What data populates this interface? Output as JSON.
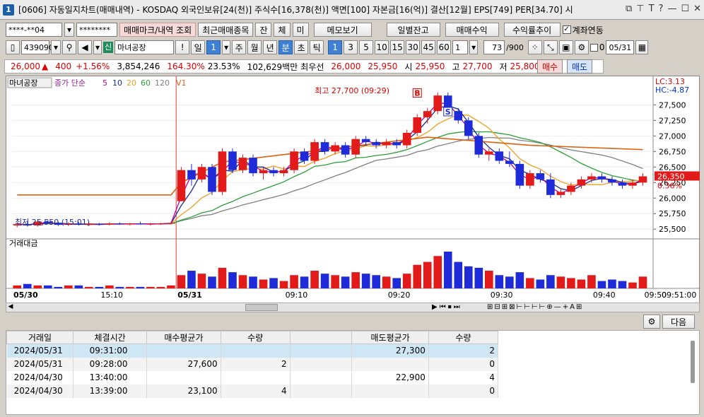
{
  "title": {
    "num": "1",
    "text": "[0606] 자동일지차트(매매내역) - KOSDAQ 외국인보유[24(천)] 주식수[16,378(천)] 액면[100] 자본금[16(억)] 결산[12월] EPS[749] PER[34.70] 시"
  },
  "toolbar1": {
    "account": "****-**04",
    "password": "********",
    "trade_mark": "매매마크/내역 조회",
    "recent": "최근매매종목",
    "b_jan": "잔",
    "b_che": "체",
    "b_mi": "미",
    "memo": "메모보기",
    "daily": "일별잔고",
    "profit": "매매수익",
    "rate": "수익률추이",
    "link": "계좌연동"
  },
  "toolbar2": {
    "code": "439090",
    "badge": "신",
    "name": "마녀공장",
    "excl": "!",
    "period": "일",
    "one": "1",
    "ju": "주",
    "wol": "월",
    "nyeon": "년",
    "bun": "분",
    "cho": "초",
    "tik": "틱",
    "m1": "1",
    "m3": "3",
    "m5": "5",
    "m10": "10",
    "m15": "15",
    "m30": "30",
    "m45": "45",
    "m60": "60",
    "sel": "1",
    "count": "73",
    "total": "/900",
    "zero": "0",
    "date": "05/31"
  },
  "pricebar": {
    "price": "26,000",
    "arrow": "▲",
    "change": "400",
    "pct": "+1.56%",
    "volume": "3,854,246",
    "ratio": "164.30%",
    "rate2": "23.53%",
    "amount": "102,629백만",
    "best_label": "최우선",
    "best1": "26,000",
    "best2": "25,950",
    "open_l": "시",
    "open": "25,950",
    "high_l": "고",
    "high": "27,700",
    "low_l": "저",
    "low": "25,800",
    "buy": "매수",
    "sell": "매도"
  },
  "chart": {
    "legend_name": "마녀공장",
    "legend_close": "종가",
    "legend_simple": "단순",
    "ma5": "5",
    "ma10": "10",
    "ma20": "20",
    "ma60": "60",
    "ma120": "120",
    "v1": "V1",
    "lc": "LC:3.13",
    "hc": "HC:-4.87",
    "max_label": "최고 27,700 (09:29)",
    "min_label": "최저 25,550 (15:01)",
    "last_price": "26,350",
    "last_pct": "0.36%",
    "vol_title": "거래대금",
    "mark_buy": "B",
    "mark_sell": "S",
    "y_ticks": [
      "27,500",
      "27,250",
      "27,000",
      "26,750",
      "26,500",
      "26,250",
      "26,000",
      "25,750",
      "25,500"
    ],
    "x_ticks": [
      "05/30",
      "15:10",
      "05/31",
      "09:10",
      "09:20",
      "09:30",
      "09:40",
      "09:50",
      "09:51:00"
    ],
    "colors": {
      "up": "#e31a1a",
      "down": "#1f2bd9",
      "ma5": "#c0009e",
      "ma10": "#1a2b8c",
      "ma20": "#f0a020",
      "ma60": "#2e9e3a",
      "ma120": "#808080",
      "ref": "#e06010"
    }
  },
  "grid": {
    "next": "다음",
    "headers": [
      "거래일",
      "체결시간",
      "매수평균가",
      "수량",
      "",
      "매도평균가",
      "수량"
    ],
    "rows": [
      [
        "2024/05/31",
        "09:31:00",
        "",
        "",
        "",
        "27,300",
        "2"
      ],
      [
        "2024/05/31",
        "09:28:00",
        "27,600",
        "2",
        "",
        "",
        "0"
      ],
      [
        "2024/04/30",
        "13:40:00",
        "",
        "",
        "",
        "22,900",
        "4"
      ],
      [
        "2024/04/30",
        "13:39:00",
        "23,100",
        "4",
        "",
        "",
        "0"
      ]
    ]
  },
  "chart_data": {
    "type": "candlestick",
    "title": "마녀공장 1분",
    "ylim": [
      25400,
      27800
    ],
    "candles": [
      [
        25560,
        25600,
        25530,
        25580
      ],
      [
        25580,
        25620,
        25540,
        25560
      ],
      [
        25560,
        25640,
        25540,
        25620
      ],
      [
        25620,
        25650,
        25580,
        25600
      ],
      [
        25600,
        25620,
        25550,
        25570
      ],
      [
        25570,
        25610,
        25550,
        25590
      ],
      [
        25590,
        25620,
        25560,
        25570
      ],
      [
        25570,
        25600,
        25550,
        25580
      ],
      [
        25580,
        25600,
        25560,
        25575
      ],
      [
        25575,
        25610,
        25560,
        25590
      ],
      [
        25590,
        25610,
        25570,
        25580
      ],
      [
        25580,
        25600,
        25560,
        25590
      ],
      [
        25590,
        25620,
        25570,
        25580
      ],
      [
        25580,
        25600,
        25560,
        25585
      ],
      [
        25585,
        25600,
        25570,
        25590
      ],
      [
        25590,
        25620,
        25575,
        25600
      ],
      [
        25950,
        26500,
        25950,
        26450
      ],
      [
        26450,
        26550,
        26200,
        26300
      ],
      [
        26300,
        26550,
        26250,
        26500
      ],
      [
        26500,
        26550,
        26050,
        26100
      ],
      [
        26100,
        26800,
        26050,
        26750
      ],
      [
        26750,
        26800,
        26400,
        26450
      ],
      [
        26450,
        26700,
        26400,
        26650
      ],
      [
        26650,
        26700,
        26350,
        26400
      ],
      [
        26400,
        26500,
        26300,
        26450
      ],
      [
        26450,
        26500,
        26350,
        26400
      ],
      [
        26400,
        26500,
        26350,
        26450
      ],
      [
        26450,
        26800,
        26400,
        26750
      ],
      [
        26750,
        26800,
        26550,
        26600
      ],
      [
        26600,
        26950,
        26550,
        26900
      ],
      [
        26900,
        26950,
        26700,
        26750
      ],
      [
        26750,
        26900,
        26700,
        26850
      ],
      [
        26850,
        26900,
        26650,
        26700
      ],
      [
        26700,
        27000,
        26650,
        26950
      ],
      [
        26950,
        27000,
        26850,
        26900
      ],
      [
        26900,
        26950,
        26800,
        26850
      ],
      [
        26850,
        26950,
        26800,
        26900
      ],
      [
        26900,
        26950,
        26800,
        26850
      ],
      [
        26850,
        27100,
        26800,
        27050
      ],
      [
        27050,
        27350,
        27000,
        27300
      ],
      [
        27300,
        27450,
        27200,
        27400
      ],
      [
        27400,
        27700,
        27350,
        27650
      ],
      [
        27650,
        27700,
        27350,
        27400
      ],
      [
        27400,
        27450,
        27200,
        27250
      ],
      [
        27250,
        27300,
        26950,
        27000
      ],
      [
        27000,
        27050,
        26650,
        26700
      ],
      [
        26700,
        26800,
        26600,
        26750
      ],
      [
        26750,
        26800,
        26550,
        26600
      ],
      [
        26600,
        26750,
        26500,
        26550
      ],
      [
        26550,
        26600,
        26150,
        26200
      ],
      [
        26200,
        26450,
        26150,
        26400
      ],
      [
        26400,
        26450,
        26250,
        26300
      ],
      [
        26300,
        26400,
        26000,
        26050
      ],
      [
        26050,
        26150,
        26000,
        26100
      ],
      [
        26100,
        26250,
        26050,
        26200
      ],
      [
        26200,
        26350,
        26150,
        26300
      ],
      [
        26300,
        26400,
        26250,
        26350
      ],
      [
        26350,
        26400,
        26250,
        26300
      ],
      [
        26300,
        26350,
        26200,
        26250
      ],
      [
        26250,
        26300,
        26150,
        26200
      ],
      [
        26200,
        26300,
        26150,
        26250
      ],
      [
        26250,
        26400,
        26200,
        26350
      ]
    ],
    "volume": [
      2,
      3,
      2,
      2,
      1,
      2,
      2,
      1,
      1,
      2,
      1,
      1,
      1,
      1,
      1,
      2,
      9,
      12,
      10,
      8,
      14,
      11,
      9,
      8,
      6,
      7,
      5,
      9,
      8,
      12,
      10,
      9,
      8,
      11,
      10,
      9,
      8,
      7,
      10,
      16,
      18,
      22,
      25,
      18,
      15,
      14,
      12,
      9,
      8,
      11,
      7,
      6,
      9,
      8,
      7,
      6,
      9,
      5,
      6,
      5,
      4,
      8
    ],
    "volume_dir": [
      1,
      0,
      1,
      0,
      0,
      1,
      0,
      1,
      0,
      1,
      0,
      1,
      0,
      1,
      1,
      1,
      1,
      0,
      1,
      0,
      1,
      0,
      1,
      0,
      1,
      0,
      1,
      1,
      0,
      1,
      0,
      1,
      0,
      1,
      0,
      0,
      1,
      0,
      1,
      1,
      1,
      1,
      0,
      0,
      0,
      0,
      1,
      0,
      0,
      0,
      1,
      0,
      0,
      1,
      1,
      1,
      1,
      0,
      0,
      0,
      1,
      1
    ]
  }
}
